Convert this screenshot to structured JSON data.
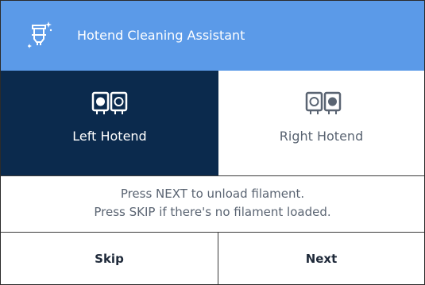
{
  "header": {
    "title": "Hotend Cleaning Assistant",
    "icon": "hotend-sparkle-icon",
    "color": "#5b9ae8"
  },
  "hotends": {
    "left": {
      "label": "Left Hotend",
      "selected": true,
      "icon": "dual-hotend-left-active-icon"
    },
    "right": {
      "label": "Right Hotend",
      "selected": false,
      "icon": "dual-hotend-right-active-icon"
    },
    "selected_color": "#0b2a4d"
  },
  "message": {
    "line1": "Press NEXT to unload filament.",
    "line2": "Press SKIP if there's no filament loaded."
  },
  "footer": {
    "skip_label": "Skip",
    "next_label": "Next"
  }
}
